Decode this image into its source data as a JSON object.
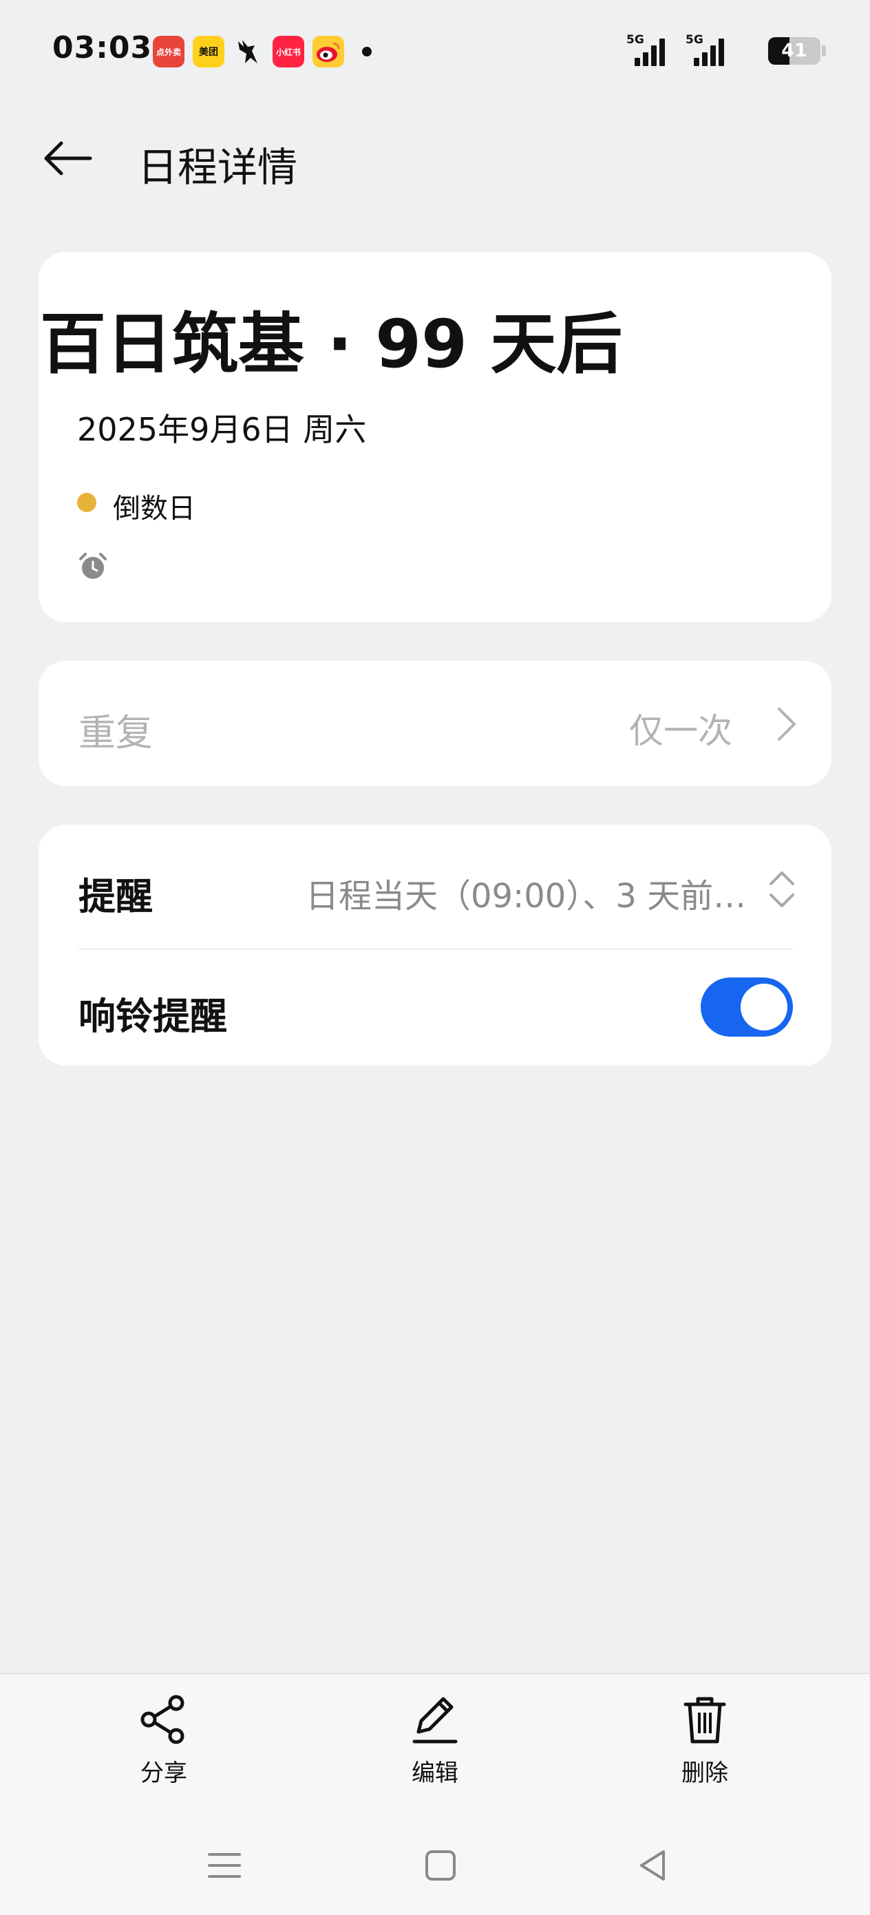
{
  "status_bar": {
    "time": "03:03",
    "app_icons": [
      {
        "name": "eleme",
        "text": "点外卖"
      },
      {
        "name": "meituan",
        "text": "美团"
      },
      {
        "name": "deer",
        "text": ""
      },
      {
        "name": "xiaohongshu",
        "text": "小红书"
      },
      {
        "name": "weibo",
        "text": ""
      }
    ],
    "signal_1_tag": "5G",
    "signal_2_tag": "5G",
    "battery_level": "41",
    "battery_fraction": 0.41
  },
  "header": {
    "title": "日程详情",
    "back_icon": "arrow-left-icon"
  },
  "event": {
    "title": "百日筑基 · 99 天后",
    "date": "2025年9月6日 周六",
    "category": "倒数日",
    "category_color": "#e8b23a",
    "alarm_icon": "alarm-clock-icon"
  },
  "repeat": {
    "label": "重复",
    "value": "仅一次"
  },
  "reminder": {
    "label": "提醒",
    "value": "日程当天（09:00）、3 天前…",
    "ring_label": "响铃提醒",
    "ring_enabled": true,
    "accent": "#1766f0"
  },
  "actions": [
    {
      "label": "分享",
      "icon": "share-icon"
    },
    {
      "label": "编辑",
      "icon": "edit-pencil-icon"
    },
    {
      "label": "删除",
      "icon": "trash-icon"
    }
  ],
  "nav": {
    "menu_icon": "menu-icon",
    "home_icon": "home-square-icon",
    "back_icon": "back-triangle-icon"
  }
}
